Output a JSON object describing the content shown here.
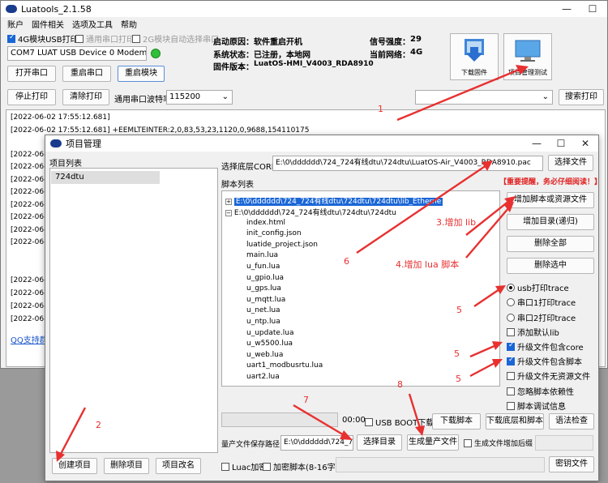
{
  "main": {
    "title": "Luatools_2.1.58",
    "menu": [
      "账户",
      "固件相关",
      "选项及工具",
      "帮助"
    ],
    "checks": [
      {
        "label": "4G模块USB打印",
        "checked": true,
        "disabled": false
      },
      {
        "label": "通用串口打印",
        "checked": false,
        "disabled": true
      },
      {
        "label": "2G模块自动选择串口",
        "checked": false,
        "disabled": true
      }
    ],
    "device": "COM7 LUAT USB Device 0 Modem (CC",
    "btn_open_port": "打开串口",
    "btn_restart_port": "重启串口",
    "btn_restart_module": "重启模块",
    "info": {
      "boot_reason_label": "启动原因：",
      "boot_reason": "软件重启开机",
      "sys_state_label": "系统状态：",
      "sys_state": "已注册，本地网",
      "fw_label": "固件版本：",
      "fw": "LuatOS-HMI_V4003_RDA8910",
      "signal_label": "信号强度：",
      "signal": "29",
      "net_label": "当前网络：",
      "net": "4G"
    },
    "btn_download_fw": "下载固件",
    "btn_project": "项目管理测试",
    "btn_stop_print": "停止打印",
    "btn_clear_print": "清除打印",
    "baud_label": "通用串口波特率",
    "baud": "115200",
    "btn_search_log": "搜索打印",
    "log_lines": [
      "[2022-06-02 17:55:12.681]",
      "[2022-06-02 17:55:12.681] +EEMLTEINTER:2,0,83,53,23,1120,0,9688,154110175",
      "[2022-06-02",
      "[2022-06-02",
      "[2022-06-02",
      "[2022-06-02",
      "[2022-06-02",
      "[2022-06-02",
      "[2022-06-02",
      "[2022-06-02",
      "[2022-06-02",
      "[2022-06-02",
      "[2022-06-02",
      "[2022-06-02"
    ],
    "qq_link": "QQ支持群"
  },
  "dialog": {
    "title": "项目管理",
    "project_list_label": "项目列表",
    "projects": [
      "724dtu"
    ],
    "core_label": "选择底层CORE",
    "core_path": "E:\\0\\dddddd\\724_724有线dtu\\724dtu\\LuatOS-Air_V4003_RDA8910.pac",
    "btn_select_file": "选择文件",
    "script_list_label": "脚本列表",
    "warning": "【重要提醒，务必仔细阅读！】",
    "tree": {
      "folder1": "E:\\0\\dddddd\\724_724有线dtu\\724dtu\\724dtu\\lib_Etherne",
      "folder2": "E:\\0\\dddddd\\724_724有线dtu\\724dtu\\724dtu",
      "files": [
        "index.html",
        "init_config.json",
        "luatide_project.json",
        "main.lua",
        "u_fun.lua",
        "u_gpio.lua",
        "u_gps.lua",
        "u_mqtt.lua",
        "u_net.lua",
        "u_ntp.lua",
        "u_update.lua",
        "u_w5500.lua",
        "u_web.lua",
        "uart1_modbusrtu.lua",
        "uart2.lua"
      ]
    },
    "btn_add_script": "增加脚本或资源文件",
    "btn_add_dir": "增加目录(递归)",
    "btn_delete_all": "删除全部",
    "btn_delete_selected": "删除选中",
    "radios": [
      {
        "label": "usb打印trace",
        "checked": true
      },
      {
        "label": "串口1打印trace",
        "checked": false
      },
      {
        "label": "串口2打印trace",
        "checked": false
      }
    ],
    "options": [
      {
        "label": "添加默认lib",
        "checked": false
      },
      {
        "label": "升级文件包含core",
        "checked": true
      },
      {
        "label": "升级文件包含脚本",
        "checked": true
      },
      {
        "label": "升级文件无资源文件",
        "checked": false
      },
      {
        "label": "忽略脚本依赖性",
        "checked": false
      },
      {
        "label": "脚本调试信息",
        "checked": false
      }
    ],
    "progress_time": "00:00",
    "usb_boot_label": "USB BOOT下载",
    "btn_download_script": "下载脚本",
    "btn_download_all": "下载底层和脚本",
    "btn_syntax_check": "语法检查",
    "output_label": "量产文件保存路径",
    "output_path": "E:\\0\\dddddd\\724_724",
    "btn_select_dir": "选择目录",
    "btn_generate": "生成量产文件",
    "gen_suffix_label": "生成文件增加后缀",
    "btn_create_project": "创建项目",
    "btn_delete_project": "删除项目",
    "btn_rename_project": "项目改名",
    "luac_label": "Luac加密",
    "encrypt_label": "加密脚本(8-16字节)",
    "btn_key_file": "密钥文件"
  },
  "annotations": {
    "n1": "1",
    "n2": "2",
    "n3": "3.增加 lib",
    "n4": "4.增加 lua 脚本",
    "n5a": "5",
    "n5b": "5",
    "n5c": "5",
    "n6": "6",
    "n7": "7",
    "n8": "8"
  },
  "colors": {
    "accent": "#1a66d6",
    "annotation": "#e83030",
    "warning": "#e02020"
  }
}
